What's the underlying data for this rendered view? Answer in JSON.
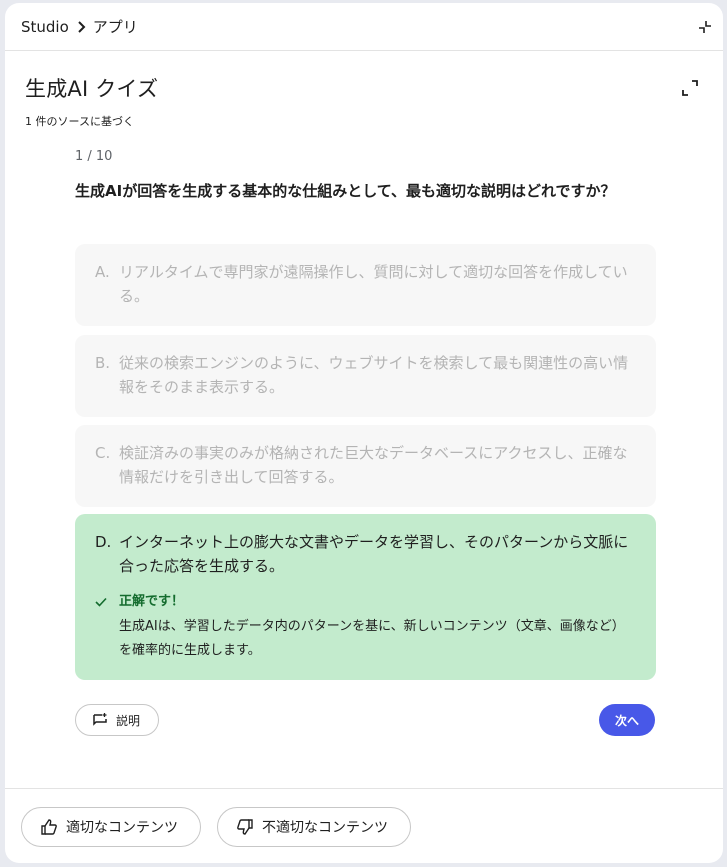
{
  "breadcrumb": {
    "root": "Studio",
    "current": "アプリ"
  },
  "header": {
    "title": "生成AI クイズ",
    "sources": "1 件のソースに基づく"
  },
  "quiz": {
    "counter": "1 / 10",
    "question": "生成AIが回答を生成する基本的な仕組みとして、最も適切な説明はどれですか？",
    "options": [
      {
        "letter": "A.",
        "text": "リアルタイムで専門家が遠隔操作し、質問に対して適切な回答を作成している。"
      },
      {
        "letter": "B.",
        "text": "従来の検索エンジンのように、ウェブサイトを検索して最も関連性の高い情報をそのまま表示する。"
      },
      {
        "letter": "C.",
        "text": "検証済みの事実のみが格納された巨大なデータベースにアクセスし、正確な情報だけを引き出して回答する。"
      },
      {
        "letter": "D.",
        "text": "インターネット上の膨大な文書やデータを学習し、そのパターンから文脈に合った応答を生成する。"
      }
    ],
    "feedback": {
      "title": "正解です！",
      "body": "生成AIは、学習したデータ内のパターンを基に、新しいコンテンツ（文章、画像など）を確率的に生成します。"
    },
    "explain_label": "説明",
    "next_label": "次へ"
  },
  "footer": {
    "good_label": "適切なコンテンツ",
    "bad_label": "不適切なコンテンツ"
  },
  "colors": {
    "accent": "#4858e8",
    "correct_bg": "#c3ebcd",
    "correct_text": "#146c2e"
  }
}
